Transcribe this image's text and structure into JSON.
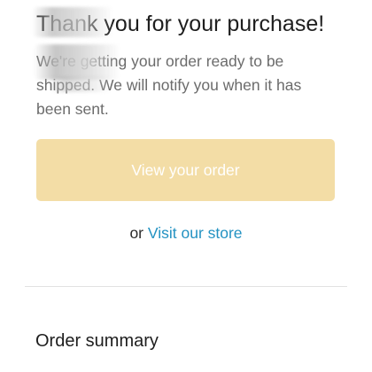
{
  "confirmation": {
    "heading": "Thank you for your purchase!",
    "message": "We're getting your order ready to be shipped. We will notify you when it has been sent."
  },
  "actions": {
    "view_order_label": "View your order",
    "alt_prefix": "or",
    "visit_store_label": "Visit our store"
  },
  "summary": {
    "title": "Order summary"
  },
  "colors": {
    "button_background": "#f3dda6",
    "button_text": "#ffffff",
    "link": "#2392c2",
    "divider": "#e2e2e2"
  }
}
